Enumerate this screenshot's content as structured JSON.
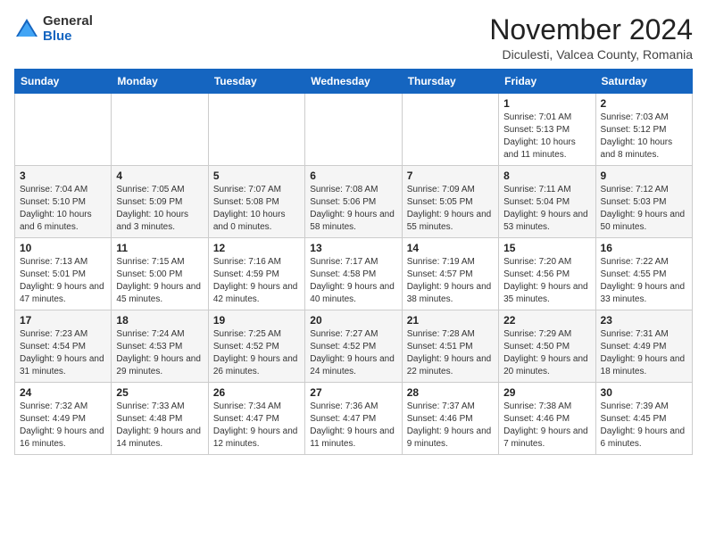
{
  "header": {
    "logo": {
      "general": "General",
      "blue": "Blue"
    },
    "title": "November 2024",
    "subtitle": "Diculesti, Valcea County, Romania"
  },
  "days_of_week": [
    "Sunday",
    "Monday",
    "Tuesday",
    "Wednesday",
    "Thursday",
    "Friday",
    "Saturday"
  ],
  "weeks": [
    [
      {
        "day": "",
        "info": ""
      },
      {
        "day": "",
        "info": ""
      },
      {
        "day": "",
        "info": ""
      },
      {
        "day": "",
        "info": ""
      },
      {
        "day": "",
        "info": ""
      },
      {
        "day": "1",
        "info": "Sunrise: 7:01 AM\nSunset: 5:13 PM\nDaylight: 10 hours and 11 minutes."
      },
      {
        "day": "2",
        "info": "Sunrise: 7:03 AM\nSunset: 5:12 PM\nDaylight: 10 hours and 8 minutes."
      }
    ],
    [
      {
        "day": "3",
        "info": "Sunrise: 7:04 AM\nSunset: 5:10 PM\nDaylight: 10 hours and 6 minutes."
      },
      {
        "day": "4",
        "info": "Sunrise: 7:05 AM\nSunset: 5:09 PM\nDaylight: 10 hours and 3 minutes."
      },
      {
        "day": "5",
        "info": "Sunrise: 7:07 AM\nSunset: 5:08 PM\nDaylight: 10 hours and 0 minutes."
      },
      {
        "day": "6",
        "info": "Sunrise: 7:08 AM\nSunset: 5:06 PM\nDaylight: 9 hours and 58 minutes."
      },
      {
        "day": "7",
        "info": "Sunrise: 7:09 AM\nSunset: 5:05 PM\nDaylight: 9 hours and 55 minutes."
      },
      {
        "day": "8",
        "info": "Sunrise: 7:11 AM\nSunset: 5:04 PM\nDaylight: 9 hours and 53 minutes."
      },
      {
        "day": "9",
        "info": "Sunrise: 7:12 AM\nSunset: 5:03 PM\nDaylight: 9 hours and 50 minutes."
      }
    ],
    [
      {
        "day": "10",
        "info": "Sunrise: 7:13 AM\nSunset: 5:01 PM\nDaylight: 9 hours and 47 minutes."
      },
      {
        "day": "11",
        "info": "Sunrise: 7:15 AM\nSunset: 5:00 PM\nDaylight: 9 hours and 45 minutes."
      },
      {
        "day": "12",
        "info": "Sunrise: 7:16 AM\nSunset: 4:59 PM\nDaylight: 9 hours and 42 minutes."
      },
      {
        "day": "13",
        "info": "Sunrise: 7:17 AM\nSunset: 4:58 PM\nDaylight: 9 hours and 40 minutes."
      },
      {
        "day": "14",
        "info": "Sunrise: 7:19 AM\nSunset: 4:57 PM\nDaylight: 9 hours and 38 minutes."
      },
      {
        "day": "15",
        "info": "Sunrise: 7:20 AM\nSunset: 4:56 PM\nDaylight: 9 hours and 35 minutes."
      },
      {
        "day": "16",
        "info": "Sunrise: 7:22 AM\nSunset: 4:55 PM\nDaylight: 9 hours and 33 minutes."
      }
    ],
    [
      {
        "day": "17",
        "info": "Sunrise: 7:23 AM\nSunset: 4:54 PM\nDaylight: 9 hours and 31 minutes."
      },
      {
        "day": "18",
        "info": "Sunrise: 7:24 AM\nSunset: 4:53 PM\nDaylight: 9 hours and 29 minutes."
      },
      {
        "day": "19",
        "info": "Sunrise: 7:25 AM\nSunset: 4:52 PM\nDaylight: 9 hours and 26 minutes."
      },
      {
        "day": "20",
        "info": "Sunrise: 7:27 AM\nSunset: 4:52 PM\nDaylight: 9 hours and 24 minutes."
      },
      {
        "day": "21",
        "info": "Sunrise: 7:28 AM\nSunset: 4:51 PM\nDaylight: 9 hours and 22 minutes."
      },
      {
        "day": "22",
        "info": "Sunrise: 7:29 AM\nSunset: 4:50 PM\nDaylight: 9 hours and 20 minutes."
      },
      {
        "day": "23",
        "info": "Sunrise: 7:31 AM\nSunset: 4:49 PM\nDaylight: 9 hours and 18 minutes."
      }
    ],
    [
      {
        "day": "24",
        "info": "Sunrise: 7:32 AM\nSunset: 4:49 PM\nDaylight: 9 hours and 16 minutes."
      },
      {
        "day": "25",
        "info": "Sunrise: 7:33 AM\nSunset: 4:48 PM\nDaylight: 9 hours and 14 minutes."
      },
      {
        "day": "26",
        "info": "Sunrise: 7:34 AM\nSunset: 4:47 PM\nDaylight: 9 hours and 12 minutes."
      },
      {
        "day": "27",
        "info": "Sunrise: 7:36 AM\nSunset: 4:47 PM\nDaylight: 9 hours and 11 minutes."
      },
      {
        "day": "28",
        "info": "Sunrise: 7:37 AM\nSunset: 4:46 PM\nDaylight: 9 hours and 9 minutes."
      },
      {
        "day": "29",
        "info": "Sunrise: 7:38 AM\nSunset: 4:46 PM\nDaylight: 9 hours and 7 minutes."
      },
      {
        "day": "30",
        "info": "Sunrise: 7:39 AM\nSunset: 4:45 PM\nDaylight: 9 hours and 6 minutes."
      }
    ]
  ]
}
